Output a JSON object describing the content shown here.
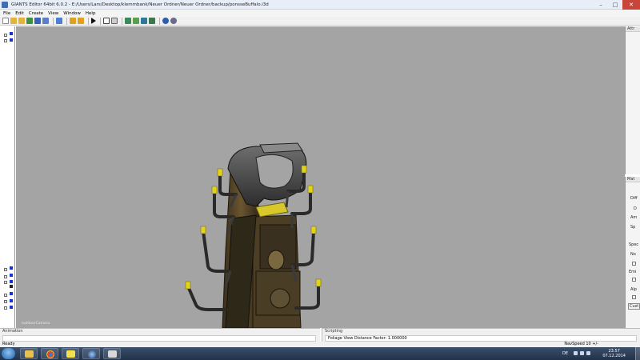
{
  "window": {
    "title": "GIANTS Editor 64bit 6.0.2 - E:/Users/Lars/Desktop/klemmbank/Neuer Ordner/Neuer Ordner/backup/ponsseBuffalo.i3d"
  },
  "menu": [
    "File",
    "Edit",
    "Create",
    "View",
    "Window",
    "Help"
  ],
  "viewport": {
    "camera_label": "outdoorCamera"
  },
  "right_panel_top": {
    "header": "Attr"
  },
  "right_panel_bottom": {
    "header": "Mat",
    "labels": [
      "Diff",
      "D",
      "Am",
      "Sp",
      "Spec",
      "No",
      "N",
      "Emi",
      "E",
      "Alp",
      "Cust"
    ]
  },
  "animation_panel": {
    "header": "Animation"
  },
  "scripting_panel": {
    "header": "Scripting",
    "output": "Foliage View Distance Factor: 1.000000"
  },
  "status": {
    "left": "Ready",
    "right": "NavSpeed 10 +/-"
  },
  "taskbar": {
    "language": "DE",
    "time": "23:57",
    "date": "07.12.2014"
  },
  "colors": {
    "viewport_bg": "#a4a4a4",
    "tree_node_blue": "#1c2fd6",
    "taskbar": "#2b3c55",
    "close_button": "#c9453a"
  },
  "icons": [
    "windows-start-icon",
    "explorer-icon",
    "chrome-icon",
    "sticky-notes-icon",
    "media-player-icon",
    "giants-editor-icon"
  ]
}
